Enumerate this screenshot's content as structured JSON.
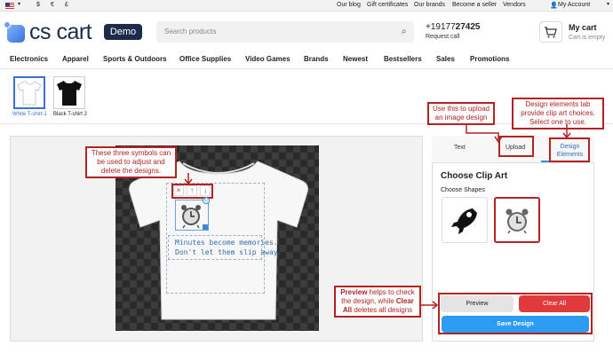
{
  "topbar": {
    "currency_usd": "$",
    "currency_eur": "€",
    "currency_gbp": "£",
    "links": [
      "Our blog",
      "Gift certificates",
      "Our brands",
      "Become a seller",
      "Vendors"
    ],
    "account": "My Account"
  },
  "header": {
    "logo_text": "cs cart",
    "demo_badge": "Demo",
    "search_placeholder": "Search products",
    "phone_prefix": "+19177",
    "phone_suffix": "27425",
    "request_call": "Request call",
    "cart_title": "My cart",
    "cart_status": "Cart is empty"
  },
  "nav": [
    "Electronics",
    "Apparel",
    "Sports & Outdoors",
    "Office Supplies",
    "Video Games",
    "Brands",
    "Newest",
    "Bestsellers",
    "Sales",
    "Promotions"
  ],
  "variants": [
    {
      "label": "White T-shirt-1",
      "selected": true,
      "color": "#ffffff"
    },
    {
      "label": "Black T-shirt 2",
      "selected": false,
      "color": "#111111"
    }
  ],
  "design": {
    "controls": [
      "×",
      "↑",
      "↓"
    ],
    "message_line1": "Minutes become memories.",
    "message_line2": "Don't let them slip away."
  },
  "annotations": {
    "controls_note": "These three symbols can be used to adjust and delete the designs.",
    "upload_note": "Use this to upload an image design",
    "design_tab_note": "Design elements tab provide clip art choices. Select one to use.",
    "preview_bold": "Preview",
    "preview_mid": " helps to check the design, while ",
    "clear_bold": "Clear All",
    "clear_tail": " deletes all designs"
  },
  "panel": {
    "tabs": [
      "Text",
      "Upload",
      "Design Elements"
    ],
    "heading": "Choose Clip Art",
    "subheading": "Choose Shapes",
    "preview_button": "Preview",
    "clear_button": "Clear All",
    "save_button": "Save Design"
  },
  "colors": {
    "accent_blue": "#2b9bf4",
    "danger_red": "#e03b3b",
    "annotation_red": "#b42222",
    "brand_navy": "#1d2b4a"
  }
}
